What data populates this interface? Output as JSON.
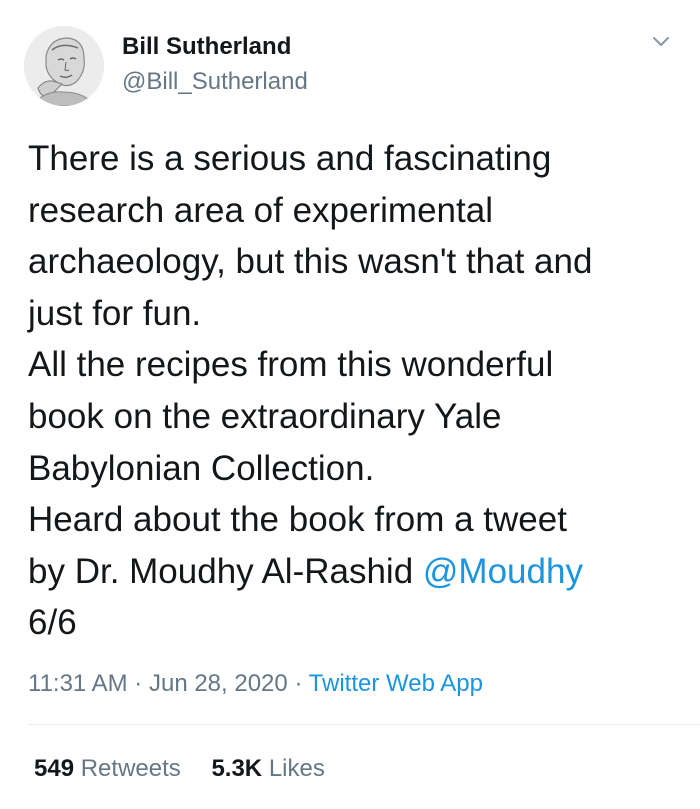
{
  "author": {
    "name": "Bill Sutherland",
    "handle": "@Bill_Sutherland"
  },
  "tweet": {
    "lines": [
      {
        "text": "There is a serious and fascinating"
      },
      {
        "text": "research area of experimental"
      },
      {
        "text": "archaeology, but this wasn't that and"
      },
      {
        "text": "just for fun."
      },
      {
        "text": "All the recipes from this wonderful"
      },
      {
        "text": "book on the extraordinary Yale"
      },
      {
        "text": "Babylonian Collection."
      },
      {
        "text": "Heard about the book from a tweet"
      },
      {
        "text": "by Dr. Moudhy Al-Rashid ",
        "mention": "@Moudhy"
      },
      {
        "text": "6/6"
      }
    ]
  },
  "meta": {
    "time": "11:31 AM",
    "separator": "·",
    "date": "Jun 28, 2020",
    "app": "Twitter Web App"
  },
  "stats": {
    "retweets_count": "549",
    "retweets_label": "Retweets",
    "likes_count": "5.3K",
    "likes_label": "Likes"
  },
  "icons": {
    "menu": "chevron-down-icon",
    "avatar": "avatar-sketch"
  },
  "colors": {
    "text": "#14171a",
    "secondary": "#657786",
    "link": "#1b95e0",
    "divider": "#e6ecf0"
  }
}
